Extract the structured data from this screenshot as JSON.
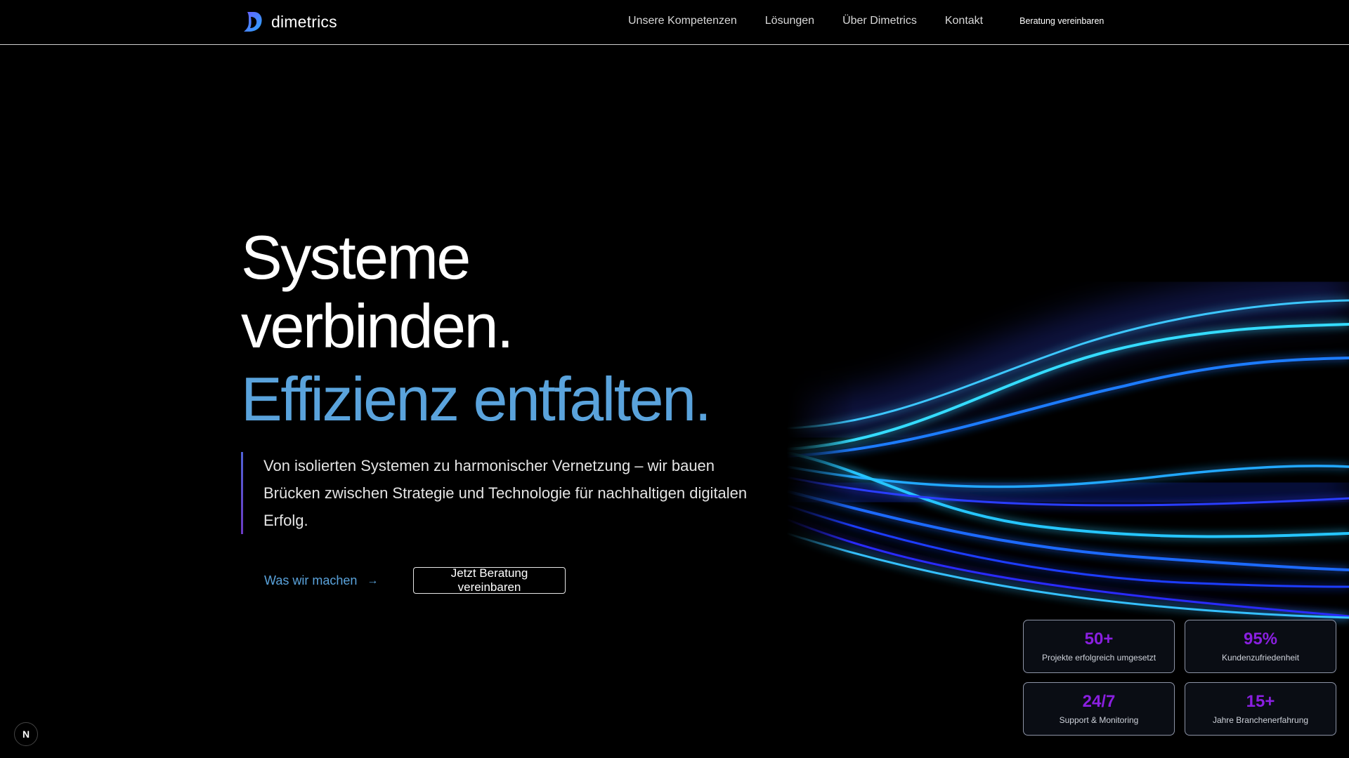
{
  "header": {
    "logo_text": "dimetrics",
    "nav": [
      "Unsere Kompetenzen",
      "Lösungen",
      "Über Dimetrics",
      "Kontakt"
    ],
    "cta": "Beratung vereinbaren"
  },
  "hero": {
    "line1": "Systeme",
    "line2": "verbinden.",
    "line3": "Effizienz entfalten.",
    "subtext": "Von isolierten Systemen zu harmonischer Vernetzung – wir bauen Brücken zwischen Strategie und Technologie für nachhaltigen digitalen Erfolg.",
    "link_label": "Was wir machen",
    "link_arrow": "→",
    "button_label": "Jetzt Beratung vereinbaren"
  },
  "stats": [
    {
      "value": "50+",
      "label": "Projekte erfolgreich umgesetzt"
    },
    {
      "value": "95%",
      "label": "Kundenzufriedenheit"
    },
    {
      "value": "24/7",
      "label": "Support & Monitoring"
    },
    {
      "value": "15+",
      "label": "Jahre Branchenerfahrung"
    }
  ],
  "badge": "N",
  "colors": {
    "accent_blue": "#5aa3dc",
    "stat_purple": "#8a1fe0",
    "wave_cyan": "#2fd3f0",
    "wave_blue": "#1f3bff"
  }
}
